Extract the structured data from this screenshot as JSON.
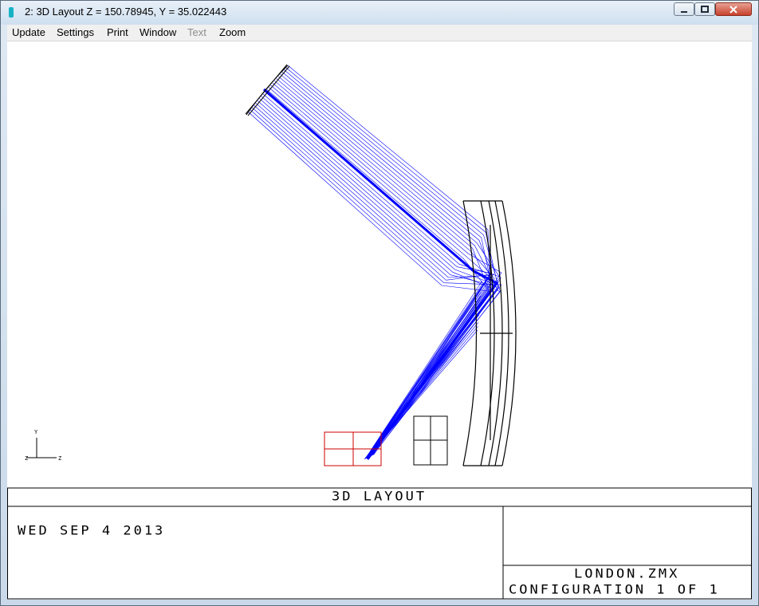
{
  "window": {
    "title": "2: 3D Layout Z = 150.78945, Y = 35.022443",
    "controls": {
      "minimize_icon": "minimize-icon",
      "maximize_icon": "maximize-icon",
      "close_icon": "close-icon"
    }
  },
  "menu": {
    "update": "Update",
    "settings": "Settings",
    "print": "Print",
    "window": "Window",
    "text": "Text",
    "zoom": "Zoom"
  },
  "layout": {
    "plot_title": "3D LAYOUT",
    "date": "WED SEP 4 2013",
    "file": "LONDON.ZMX",
    "configuration": "CONFIGURATION 1 OF 1",
    "axis_labels": {
      "vertical": "Y",
      "left": "Z",
      "right": "Z"
    }
  },
  "colors": {
    "rays": "#0000ff",
    "lens": "#000000",
    "detector": "#cc0000",
    "accent": "#17b3c4"
  }
}
